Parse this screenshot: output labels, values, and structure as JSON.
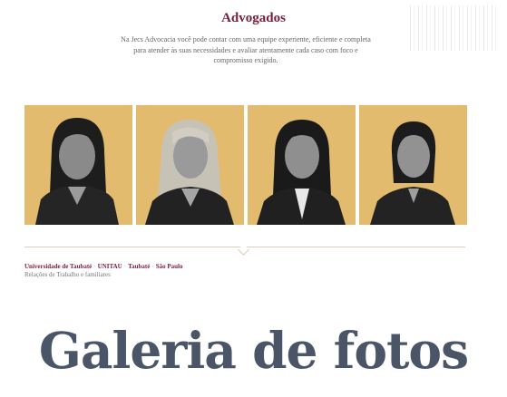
{
  "section": {
    "title": "Advogados",
    "intro": "Na Jecs Advocacia você pode contar com uma equipe experiente, eficiente e completa para atender às suas necessidades e avaliar atentamente cada caso com foco e compromisso exigido."
  },
  "team": {
    "background_color": "#e2bb6e",
    "members": [
      {
        "hair": "dark"
      },
      {
        "hair": "blonde"
      },
      {
        "hair": "dark"
      },
      {
        "hair": "dark-short"
      }
    ]
  },
  "bio": {
    "items": [
      "Universidade de Taubaté",
      "UNITAU",
      "Taubaté",
      "São Paulo"
    ],
    "separator": "·",
    "area": "Relações de Trabalho e familiares"
  },
  "gallery": {
    "title": "Galeria de fotos"
  },
  "colors": {
    "accent": "#7a1f3a",
    "heading": "#4a5568"
  }
}
